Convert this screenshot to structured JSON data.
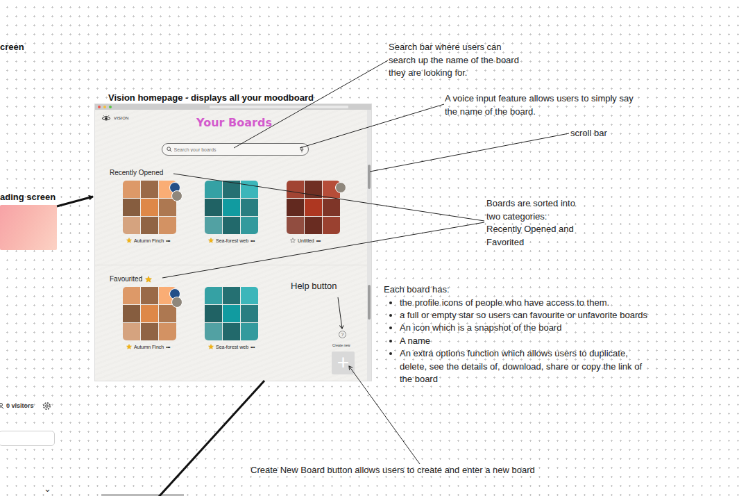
{
  "sidebar": {
    "heading": "creen",
    "loading_heading": "ading screen",
    "visitors": "0 visitors",
    "chevron": "⌄"
  },
  "frame_title": "Vision homepage - displays all your moodboard",
  "app": {
    "logo": "VISION",
    "heading": "Your Boards",
    "search": {
      "placeholder": "Search your boards"
    },
    "sections": [
      {
        "title": "Recently Opened",
        "starred": false,
        "boards": [
          {
            "name": "Autumn Finch",
            "favorite": true,
            "more": "•••",
            "color": "#c0855a",
            "avatars": 2
          },
          {
            "name": "Sea-forest web",
            "favorite": true,
            "more": "•••",
            "color": "#2e8c8f",
            "avatars": 0
          },
          {
            "name": "Untitled",
            "favorite": false,
            "more": "•••",
            "color": "#8c3b2c",
            "avatars": 1
          }
        ]
      },
      {
        "title": "Favourited",
        "starred": true,
        "boards": [
          {
            "name": "Autumn Finch",
            "favorite": true,
            "more": "•••",
            "color": "#c0855a",
            "avatars": 2
          },
          {
            "name": "Sea-forest web",
            "favorite": true,
            "more": "•••",
            "color": "#2e8c8f",
            "avatars": 0
          }
        ]
      }
    ],
    "help": "?",
    "create_label": "Create new",
    "create_icon": "+"
  },
  "annotations": [
    {
      "lines": [
        "Search bar where users can",
        "search up the name of the board",
        "they are looking for."
      ],
      "bullets": []
    },
    {
      "lines": [
        "A voice input feature allows users to simply say",
        "the name of the board."
      ],
      "bullets": []
    },
    {
      "lines": [
        "scroll bar"
      ],
      "bullets": []
    },
    {
      "lines": [
        "Boards are sorted into",
        "two categories:",
        "Recently Opened and",
        "Favorited"
      ],
      "bullets": []
    },
    {
      "lines": [
        "Help button"
      ],
      "bullets": []
    },
    {
      "lines": [
        "Each board has:"
      ],
      "bullets": [
        "the profile icons of people who have access to them.",
        "a full or empty star so users can favourite or unfavorite boards",
        "An icon which is a snapshot of the board",
        "A name",
        "An extra options function which allows users to duplicate, delete, see the details of, download, share or copy the link of the board"
      ]
    },
    {
      "lines": [
        "Create New Board button allows users to create and enter a new board"
      ],
      "bullets": []
    }
  ]
}
